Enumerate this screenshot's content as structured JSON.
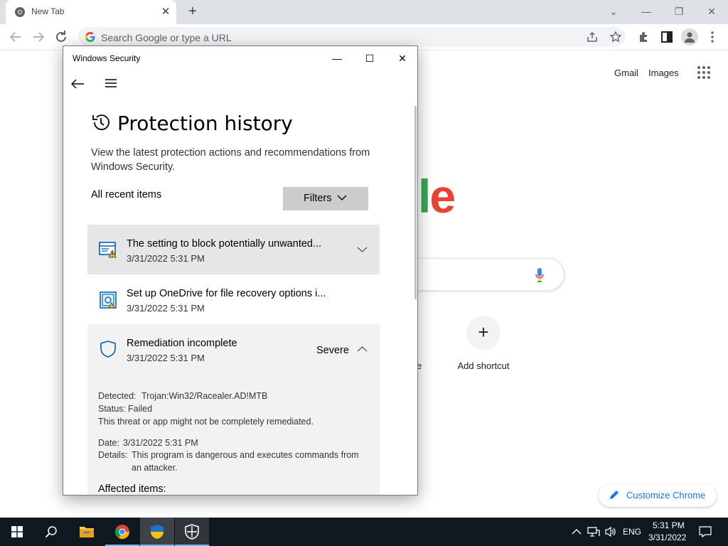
{
  "browser": {
    "tab_title": "New Tab",
    "tab_close": "✕",
    "new_tab": "+",
    "omnibox_placeholder": "Search Google or type a URL",
    "window_controls": {
      "dropdown": "⌄",
      "minimize": "—",
      "restore": "❐",
      "close": "✕"
    }
  },
  "google_page": {
    "gmail": "Gmail",
    "images": "Images",
    "logo_fragment": [
      "l",
      "e"
    ],
    "logo_colors": [
      "#34a853",
      "#ea4335"
    ],
    "other_shortcut_fragment": "e",
    "add_shortcut_symbol": "+",
    "add_shortcut": "Add shortcut",
    "customize": "Customize Chrome"
  },
  "windows_security": {
    "title": "Windows Security",
    "controls": {
      "minimize": "—",
      "maximize": "☐",
      "close": "✕"
    },
    "heading": "Protection history",
    "description": "View the latest protection actions and recommendations from Windows Security.",
    "recent_label": "All recent items",
    "filters_label": "Filters",
    "items": [
      {
        "title": "The setting to block potentially unwanted...",
        "date": "3/31/2022 5:31 PM",
        "expanded": false
      },
      {
        "title": "Set up OneDrive for file recovery options i...",
        "date": "3/31/2022 5:31 PM",
        "expanded": false
      },
      {
        "title": "Remediation incomplete",
        "date": "3/31/2022 5:31 PM",
        "severity": "Severe",
        "expanded": true,
        "detected_label": "Detected:",
        "detected_value": "Trojan:Win32/Racealer.AD!MTB",
        "status_label": "Status:",
        "status_value": "Failed",
        "note": "This threat or app might not be completely remediated.",
        "date_label": "Date:",
        "date_value": "3/31/2022 5:31 PM",
        "details_label": "Details:",
        "details_line1": "This program is dangerous and executes commands from",
        "details_line2": "an attacker.",
        "affected_label": "Affected items:"
      }
    ]
  },
  "taskbar": {
    "time": "5:31 PM",
    "date": "3/31/2022",
    "language": "ENG",
    "apps": [
      "windows-start",
      "search",
      "file-explorer",
      "chrome",
      "security-shield-uac",
      "windows-security"
    ]
  }
}
